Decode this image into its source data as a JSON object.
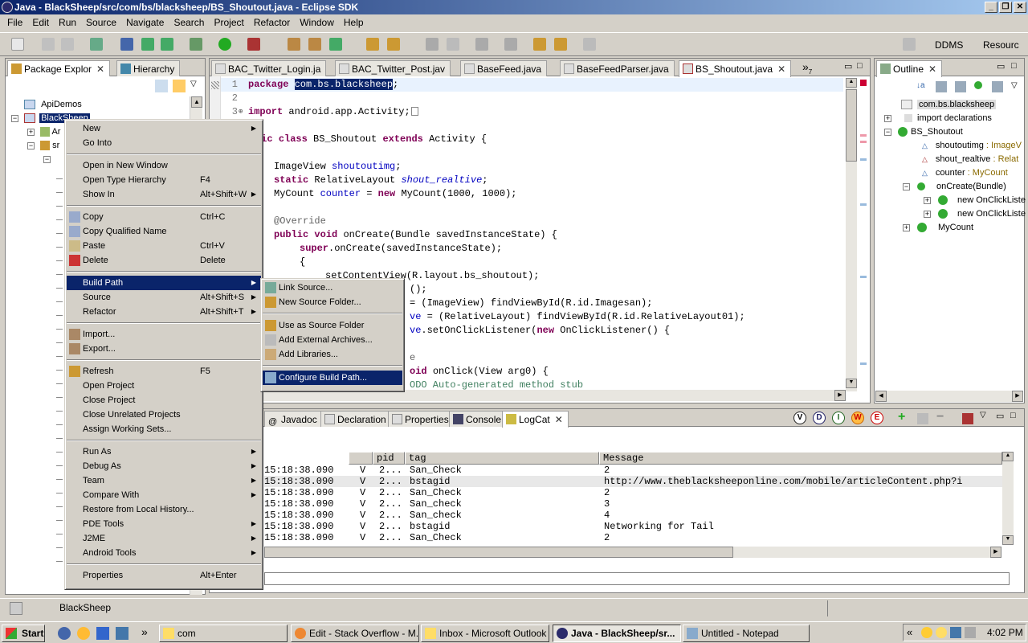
{
  "window": {
    "title": "Java - BlackSheep/src/com/bs/blacksheep/BS_Shoutout.java - Eclipse SDK",
    "min": "_",
    "max": "❐",
    "close": "✕"
  },
  "menubar": [
    "File",
    "Edit",
    "Run",
    "Source",
    "Navigate",
    "Search",
    "Project",
    "Refactor",
    "Window",
    "Help"
  ],
  "perspectives": {
    "ddms": "DDMS",
    "resource": "Resourc"
  },
  "left_tabs": {
    "package_explorer": "Package Explor",
    "hierarchy": "Hierarchy"
  },
  "tree": {
    "apidemos": "ApiDemos",
    "blacksheep": "BlackSheep",
    "partial1": "Ar",
    "partial2": "sr"
  },
  "editor_tabs": [
    "BAC_Twitter_Login.ja",
    "BAC_Twitter_Post.jav",
    "BaseFeed.java",
    "BaseFeedParser.java",
    "BS_Shoutout.java"
  ],
  "editor_overflow": "»",
  "editor_overflow_count": "7",
  "code": {
    "line_numbers": [
      "1",
      "2",
      "3"
    ],
    "l1_kw": "package ",
    "l1_pkg": "com.bs.blacksheep",
    "l1_end": ";",
    "l3_kw": "import ",
    "l3_rest": "android.app.Activity;",
    "l5_kw1": "lic ",
    "l5_kw2": "class ",
    "l5_a": "BS_Shoutout ",
    "l5_kw3": "extends ",
    "l5_b": "Activity {",
    "l7_a": "ImageView ",
    "l7_f": "shoutoutimg",
    "l7_b": ";",
    "l8_kw": "static ",
    "l8_a": "RelativeLayout ",
    "l8_f": "shout_realtive",
    "l8_b": ";",
    "l9_a": "MyCount ",
    "l9_f": "counter",
    "l9_b": " = ",
    "l9_kw": "new ",
    "l9_c": "MyCount(1000, 1000);",
    "l11_ann": "@Override",
    "l12_kw1": "public ",
    "l12_kw2": "void ",
    "l12_a": "onCreate(Bundle savedInstanceState) {",
    "l13_kw": "super",
    "l13_a": ".onCreate(savedInstanceState);",
    "l14_a": "{",
    "l15_a": "setContentView(R.layout.bs_shoutout);",
    "l16_a": "();",
    "l17_a": "= (ImageView) findViewById(R.id.Imagesan);",
    "l18_f": "ve",
    "l18_a": " = (RelativeLayout) findViewById(R.id.RelativeLayout01);",
    "l19_f": "ve",
    "l19_a": ".setOnClickListener(",
    "l19_kw": "new ",
    "l19_b": "OnClickListener() {",
    "l20_ann": "e",
    "l21_kw": "oid ",
    "l21_a": "onClick(View arg0) {",
    "l22_cmt": "ODO Auto-generated method stub"
  },
  "outline": {
    "tab": "Outline",
    "items": [
      "com.bs.blacksheep",
      "import declarations",
      "BS_Shoutout",
      "shoutoutimg",
      "shout_realtive",
      "counter",
      "onCreate(Bundle)",
      "new OnClickListe",
      "new OnClickListe",
      "MyCount"
    ],
    "types": {
      "shoutoutimg": " : ImageV",
      "shout_realtive": " : Relat",
      "counter": " : MyCount"
    }
  },
  "bottom_tabs": [
    "Javadoc",
    "Declaration",
    "Properties",
    "Console",
    "LogCat"
  ],
  "logcat_buttons": [
    "V",
    "D",
    "I",
    "W",
    "E"
  ],
  "logcat": {
    "headers": [
      "pid",
      "tag",
      "Message"
    ],
    "rows": [
      {
        "time": "15:18:38.090",
        "level": "V",
        "pid": "2...",
        "tag": "San_Check",
        "message": "2"
      },
      {
        "time": "15:18:38.090",
        "level": "V",
        "pid": "2...",
        "tag": "bstagid",
        "message": "http://www.theblacksheeponline.com/mobile/articleContent.php?i"
      },
      {
        "time": "15:18:38.090",
        "level": "V",
        "pid": "2...",
        "tag": "San_Check",
        "message": "2"
      },
      {
        "time": "15:18:38.090",
        "level": "V",
        "pid": "2...",
        "tag": "San_check",
        "message": "3"
      },
      {
        "time": "15:18:38.090",
        "level": "V",
        "pid": "2...",
        "tag": "San_check",
        "message": "4"
      },
      {
        "time": "15:18:38.090",
        "level": "V",
        "pid": "2...",
        "tag": "bstagid",
        "message": "Networking for Tail"
      },
      {
        "time": "15:18:38.090",
        "level": "V",
        "pid": "2...",
        "tag": "San_Check",
        "message": "2"
      }
    ]
  },
  "context_menu": {
    "items": [
      {
        "label": "New",
        "shortcut": "",
        "submenu": true
      },
      {
        "label": "Go Into",
        "shortcut": ""
      },
      {
        "label": "Open in New Window",
        "shortcut": ""
      },
      {
        "label": "Open Type Hierarchy",
        "shortcut": "F4"
      },
      {
        "label": "Show In",
        "shortcut": "Alt+Shift+W",
        "submenu": true
      },
      {
        "label": "Copy",
        "shortcut": "Ctrl+C"
      },
      {
        "label": "Copy Qualified Name",
        "shortcut": ""
      },
      {
        "label": "Paste",
        "shortcut": "Ctrl+V"
      },
      {
        "label": "Delete",
        "shortcut": "Delete"
      },
      {
        "label": "Build Path",
        "shortcut": "",
        "submenu": true
      },
      {
        "label": "Source",
        "shortcut": "Alt+Shift+S",
        "submenu": true
      },
      {
        "label": "Refactor",
        "shortcut": "Alt+Shift+T",
        "submenu": true
      },
      {
        "label": "Import...",
        "shortcut": ""
      },
      {
        "label": "Export...",
        "shortcut": ""
      },
      {
        "label": "Refresh",
        "shortcut": "F5"
      },
      {
        "label": "Open Project",
        "shortcut": ""
      },
      {
        "label": "Close Project",
        "shortcut": ""
      },
      {
        "label": "Close Unrelated Projects",
        "shortcut": ""
      },
      {
        "label": "Assign Working Sets...",
        "shortcut": ""
      },
      {
        "label": "Run As",
        "shortcut": "",
        "submenu": true
      },
      {
        "label": "Debug As",
        "shortcut": "",
        "submenu": true
      },
      {
        "label": "Team",
        "shortcut": "",
        "submenu": true
      },
      {
        "label": "Compare With",
        "shortcut": "",
        "submenu": true
      },
      {
        "label": "Restore from Local History...",
        "shortcut": ""
      },
      {
        "label": "PDE Tools",
        "shortcut": "",
        "submenu": true
      },
      {
        "label": "J2ME",
        "shortcut": "",
        "submenu": true
      },
      {
        "label": "Android Tools",
        "shortcut": "",
        "submenu": true
      },
      {
        "label": "Properties",
        "shortcut": "Alt+Enter"
      }
    ]
  },
  "submenu": {
    "items": [
      "Link Source...",
      "New Source Folder...",
      "Use as Source Folder",
      "Add External Archives...",
      "Add Libraries...",
      "Configure Build Path..."
    ]
  },
  "status": {
    "text": "BlackSheep"
  },
  "taskbar": {
    "start": "Start",
    "tasks": [
      "com",
      "Edit - Stack Overflow - M...",
      "Inbox - Microsoft Outlook",
      "Java - BlackSheep/sr...",
      "Untitled - Notepad"
    ],
    "clock": "4:02 PM",
    "chevron": "»",
    "tray_chevron": "«"
  },
  "colors": {
    "selection": "#0a246a",
    "keyword": "#7f0055",
    "field": "#0000c0",
    "comment": "#3f7f5f"
  }
}
